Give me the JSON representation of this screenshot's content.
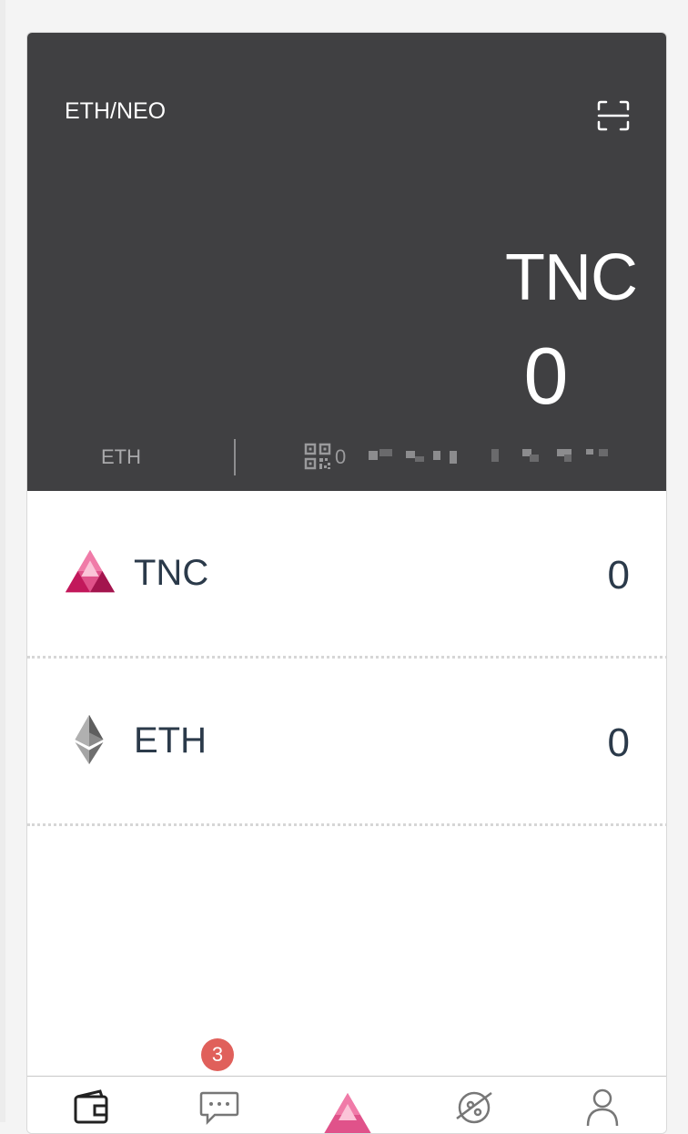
{
  "header": {
    "network": "ETH/NEO",
    "token": "TNC",
    "balance": "0",
    "chain": "ETH",
    "address": "0"
  },
  "assets": [
    {
      "name": "TNC",
      "value": "0",
      "icon": "tnc-logo-icon"
    },
    {
      "name": "ETH",
      "value": "0",
      "icon": "ethereum-logo-icon"
    }
  ],
  "tabbar": {
    "messages_badge": "3",
    "tabs": [
      "wallet-icon",
      "chat-icon",
      "tnc-logo-icon",
      "discover-icon",
      "profile-icon"
    ]
  },
  "colors": {
    "header_bg": "#404042",
    "badge": "#e0605b",
    "text": "#2b3a4a",
    "brand": "#c2185b"
  }
}
